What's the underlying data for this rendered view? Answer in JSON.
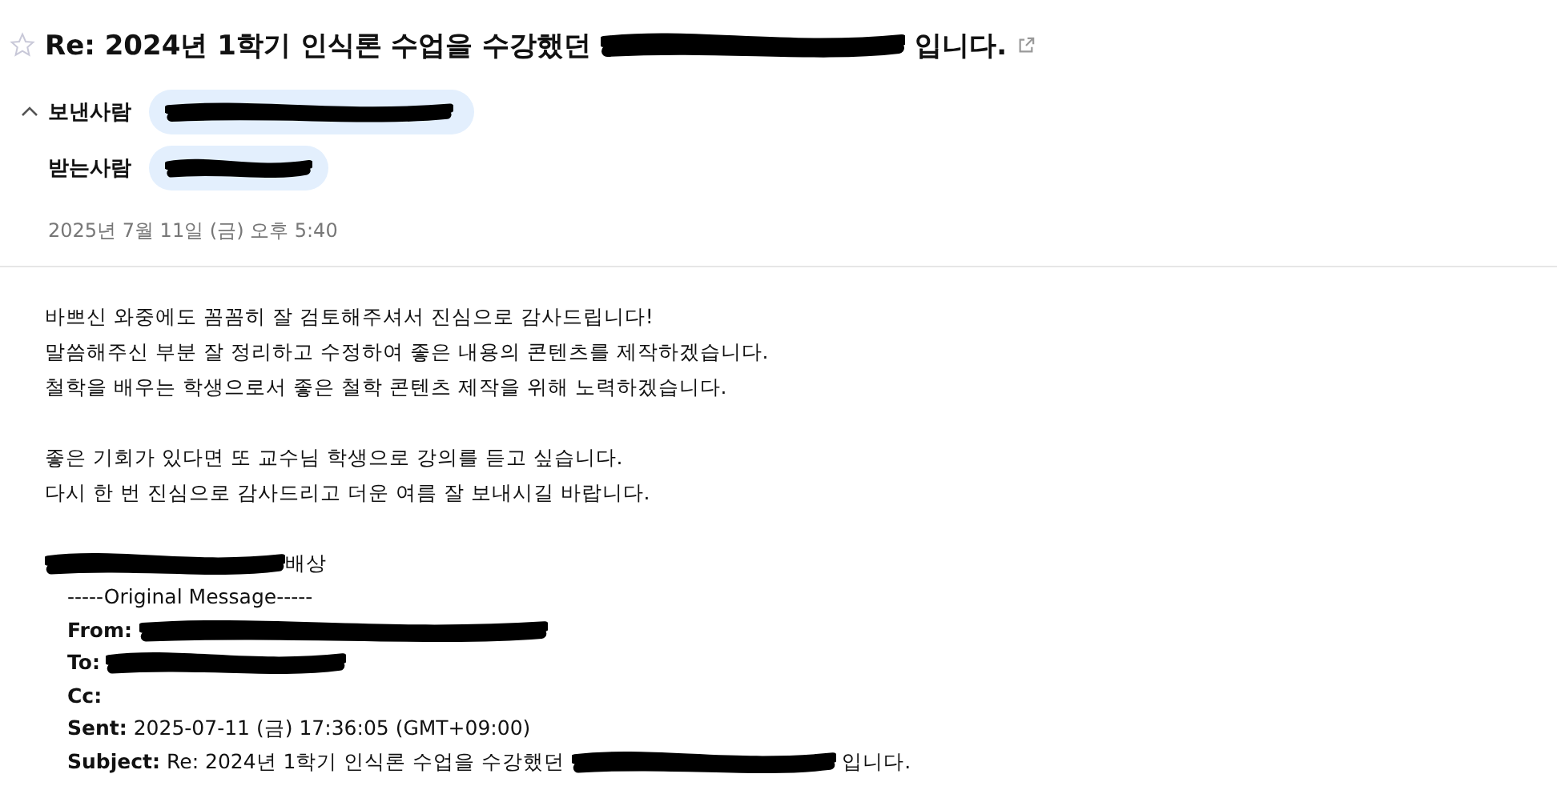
{
  "subject": {
    "starred": false,
    "before": "Re: 2024년 1학기 인식론 수업을 수강했던",
    "after": "입니다."
  },
  "headers": {
    "expanded": true,
    "sender_label": "보낸사람",
    "recipient_label": "받는사람"
  },
  "date": "2025년 7월 11일 (금) 오후 5:40",
  "body": [
    [
      "바쁘신 와중에도 꼼꼼히 잘 검토해주셔서 진심으로 감사드립니다!",
      "말씀해주신 부분 잘 정리하고 수정하여 좋은 내용의 콘텐츠를 제작하겠습니다.",
      "철학을 배우는 학생으로서 좋은 철학 콘텐츠 제작을 위해 노력하겠습니다."
    ],
    [
      "좋은 기회가 있다면 또 교수님 학생으로 강의를 듣고 싶습니다.",
      "다시 한 번 진심으로 감사드리고 더운 여름 잘 보내시길 바랍니다."
    ]
  ],
  "signature": "배상",
  "original": {
    "title": "-----Original Message-----",
    "fields": [
      {
        "label": "From:",
        "redacted": true
      },
      {
        "label": "To:",
        "redacted": true
      },
      {
        "label": "Cc:",
        "redacted": false
      },
      {
        "label": "Sent:",
        "value": "2025-07-11 (금) 17:36:05 (GMT+09:00)",
        "redacted": false
      },
      {
        "label": "Subject:",
        "value": "Re: 2024년 1학기 인식론 수업을 수강했던",
        "after": "입니다.",
        "redacted": true
      }
    ]
  }
}
